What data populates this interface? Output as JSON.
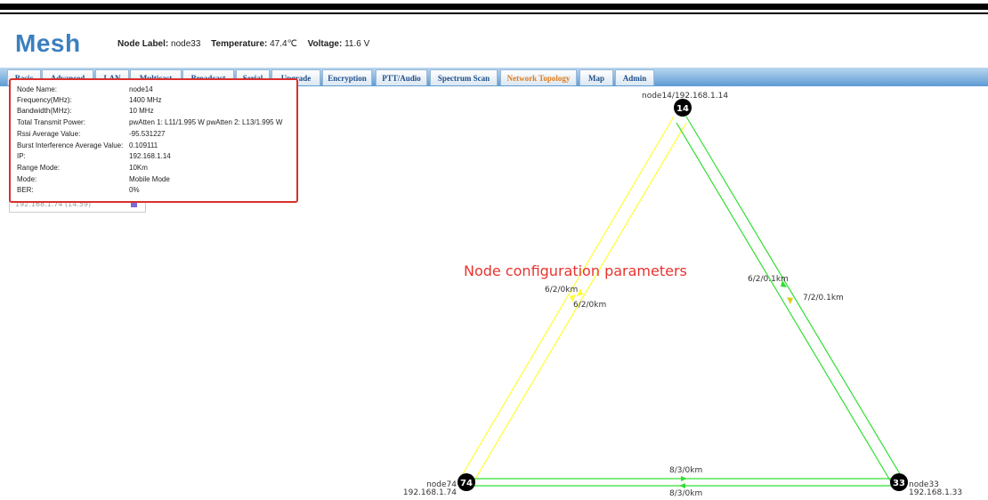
{
  "app": {
    "title": "Mesh"
  },
  "status": {
    "node_label_key": "Node Label:",
    "node_label_value": "node33",
    "temperature_key": "Temperature:",
    "temperature_value": "47.4℃",
    "voltage_key": "Voltage:",
    "voltage_value": "11.6 V"
  },
  "tabs": [
    {
      "label": "Basic"
    },
    {
      "label": "Advanced"
    },
    {
      "label": "LAN"
    },
    {
      "label": "Multicast"
    },
    {
      "label": "Broadcast"
    },
    {
      "label": "Serial"
    },
    {
      "label": "Upgrade"
    },
    {
      "label": "Encryption"
    },
    {
      "label": "PTT/Audio"
    },
    {
      "label": "Spectrum Scan"
    },
    {
      "label": "Network Topology",
      "active": true
    },
    {
      "label": "Map"
    },
    {
      "label": "Admin"
    }
  ],
  "info": {
    "rows": [
      {
        "key": "Node Name:",
        "value": "node14"
      },
      {
        "key": "Frequency(MHz):",
        "value": "1400 MHz"
      },
      {
        "key": "Bandwidth(MHz):",
        "value": "10 MHz"
      },
      {
        "key": "Total Transmit Power:",
        "value": "pwAtten 1: L11/1.995 W   pwAtten 2: L13/1.995 W"
      },
      {
        "key": "Rssi Average Value:",
        "value": "-95.531227"
      },
      {
        "key": "Burst Interference Average Value:",
        "value": "0.109111"
      },
      {
        "key": "IP:",
        "value": "192.168.1.14"
      },
      {
        "key": "Range Mode:",
        "value": "10Km"
      },
      {
        "key": "Mode:",
        "value": "Mobile Mode"
      },
      {
        "key": "BER:",
        "value": "0%"
      }
    ],
    "underlay_text": "192.168.1.74 (14.59)"
  },
  "annotation": {
    "text": "Node configuration parameters",
    "color": "#e8332f"
  },
  "topology": {
    "nodes": [
      {
        "id": "14",
        "name": "node14",
        "ip": "192.168.1.14",
        "label": "node14/192.168.1.14"
      },
      {
        "id": "74",
        "name": "node74",
        "ip": "192.168.1.74"
      },
      {
        "id": "33",
        "name": "node33",
        "ip": "192.168.1.33"
      }
    ],
    "links": [
      {
        "label": "6/2/0km",
        "color": "#ffff33"
      },
      {
        "label": "6/2/0km",
        "color": "#ffff33"
      },
      {
        "label": "6/2/0.1km",
        "color": "#33dd33"
      },
      {
        "label": "7/2/0.1km",
        "color": "#33dd33"
      },
      {
        "label": "8/3/0km",
        "color": "#33dd33"
      },
      {
        "label": "8/3/0km",
        "color": "#33dd33"
      }
    ]
  },
  "colors": {
    "brand": "#3b7fbf",
    "tab_active": "#e07b1a",
    "border_red": "#d9302c"
  }
}
